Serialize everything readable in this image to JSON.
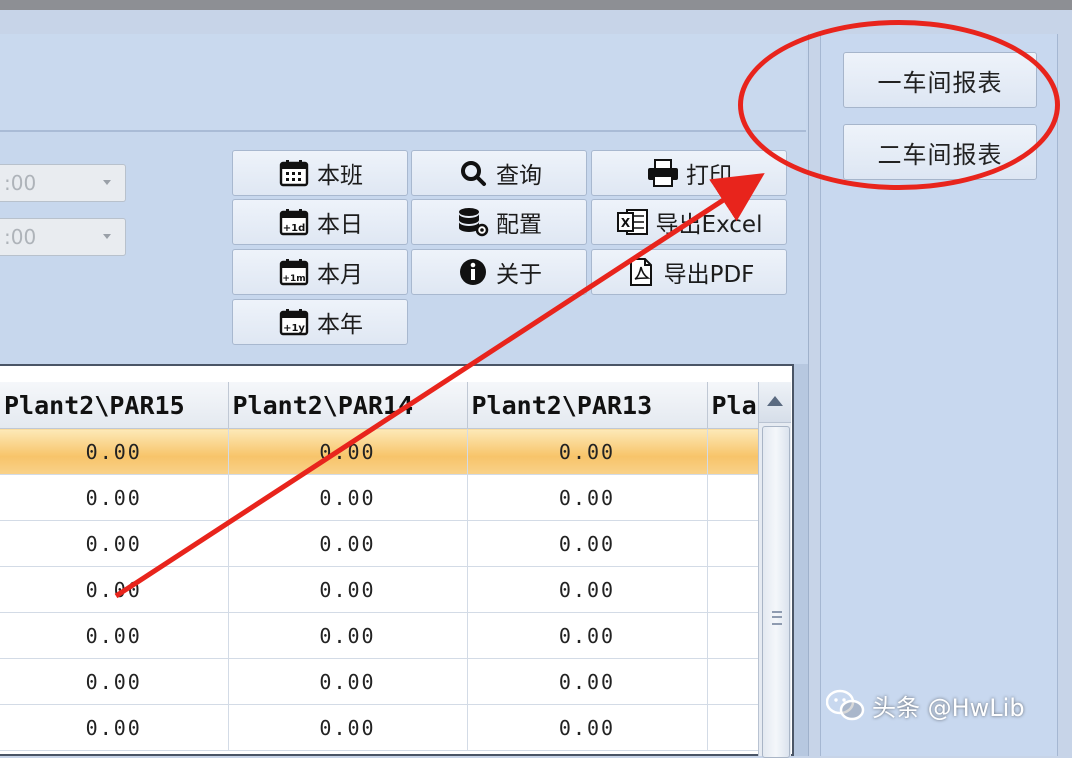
{
  "toolbar": {
    "shift": "本班",
    "query": "查询",
    "print": "打印",
    "day": "本日",
    "config": "配置",
    "export_excel": "导出Excel",
    "month": "本月",
    "about": "关于",
    "export_pdf": "导出PDF",
    "year": "本年"
  },
  "time_inputs": [
    ":00",
    ":00"
  ],
  "right_buttons": [
    "一车间报表",
    "二车间报表"
  ],
  "grid": {
    "columns": [
      "Plant2\\PAR15",
      "Plant2\\PAR14",
      "Plant2\\PAR13",
      "Pla"
    ],
    "rows": [
      [
        "0.00",
        "0.00",
        "0.00",
        ""
      ],
      [
        "0.00",
        "0.00",
        "0.00",
        ""
      ],
      [
        "0.00",
        "0.00",
        "0.00",
        ""
      ],
      [
        "0.00",
        "0.00",
        "0.00",
        ""
      ],
      [
        "0.00",
        "0.00",
        "0.00",
        ""
      ],
      [
        "0.00",
        "0.00",
        "0.00",
        ""
      ],
      [
        "0.00",
        "0.00",
        "0.00",
        ""
      ]
    ],
    "selected_row": 0
  },
  "watermark": "头条 @HwLib",
  "colors": {
    "annotation": "#e8241c",
    "selected_row": "#f7c46a",
    "panel": "#c8d8ef"
  },
  "icons": {
    "shift": "calendar-icon",
    "query": "search-icon",
    "print": "printer-icon",
    "day": "calendar-day-icon",
    "config": "database-gear-icon",
    "export_excel": "excel-icon",
    "month": "calendar-month-icon",
    "about": "info-icon",
    "export_pdf": "pdf-icon",
    "year": "calendar-year-icon"
  }
}
